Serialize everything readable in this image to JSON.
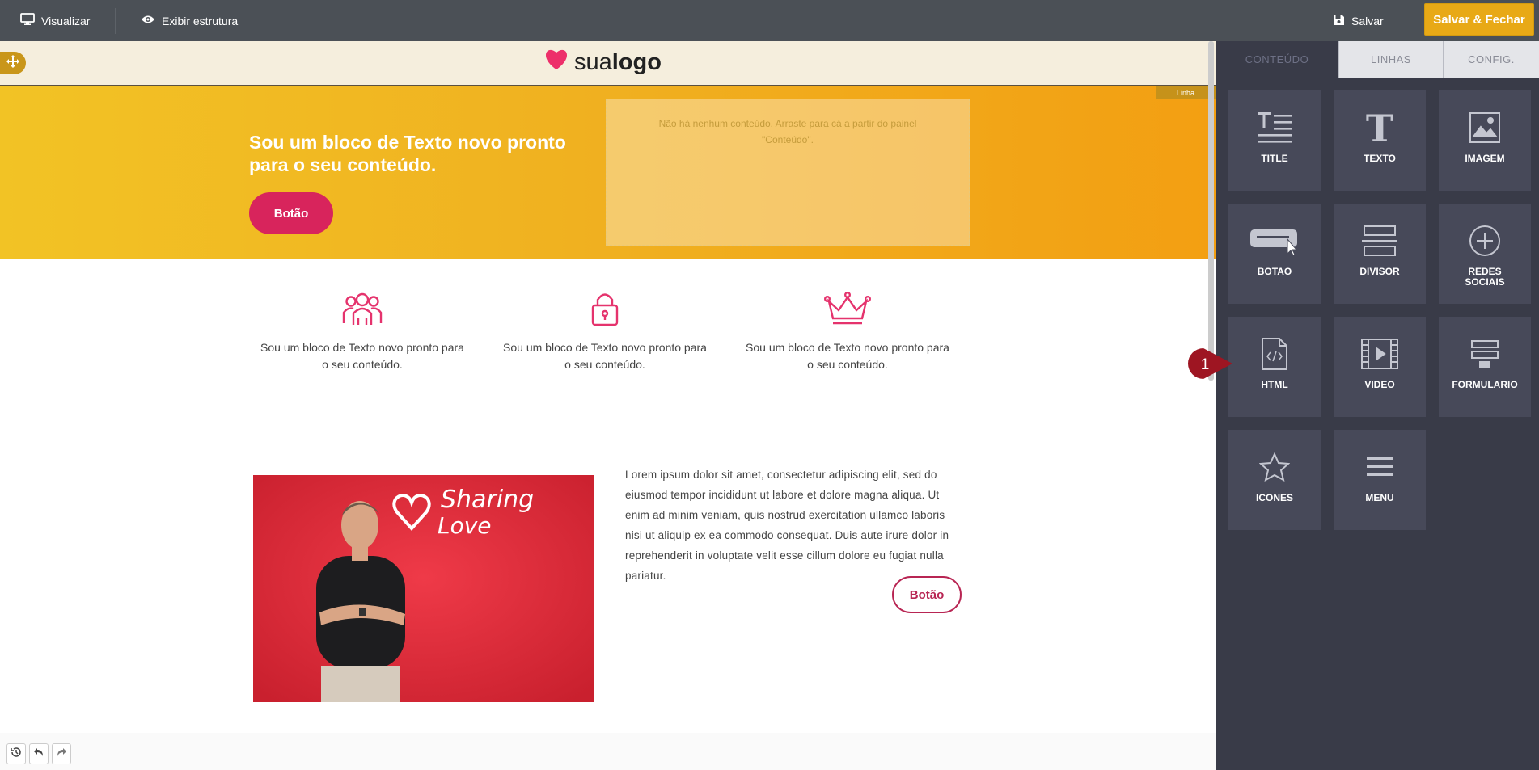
{
  "toolbar": {
    "preview_label": "Visualizar",
    "structure_label": "Exibir estrutura",
    "save_label": "Salvar",
    "save_close_label": "Salvar & Fechar"
  },
  "canvas": {
    "logo": {
      "text_light": "sua",
      "text_bold": "logo"
    },
    "row_tag": "Linha",
    "hero": {
      "title": "Sou um bloco de Texto novo pronto para o seu conteúdo.",
      "button_label": "Botão",
      "empty_message": "Não há nenhum conteúdo. Arraste para cá a partir do painel \"Conteúdo\"."
    },
    "features": [
      {
        "icon": "team-icon",
        "text": "Sou um bloco de Texto novo pronto para o seu conteúdo."
      },
      {
        "icon": "lock-icon",
        "text": "Sou um bloco de Texto novo pronto para o seu conteúdo."
      },
      {
        "icon": "crown-icon",
        "text": "Sou um bloco de Texto novo pronto para o seu conteúdo."
      }
    ],
    "photo_text": {
      "line1": "Sharing",
      "line2": "Love"
    },
    "lorem": "Lorem ipsum dolor sit amet, consectetur adipiscing elit, sed do eiusmod tempor incididunt ut labore et dolore magna aliqua. Ut enim ad minim veniam, quis nostrud exercitation ullamco laboris nisi ut aliquip ex ea commodo consequat. Duis aute irure dolor in reprehenderit in voluptate velit esse cillum dolore eu fugiat nulla pariatur.",
    "outline_button_label": "Botão"
  },
  "panel": {
    "tabs": [
      {
        "label": "CONTEÚDO",
        "active": true
      },
      {
        "label": "LINHAS",
        "active": false
      },
      {
        "label": "CONFIG.",
        "active": false
      }
    ],
    "tiles": [
      {
        "label": "TITLE",
        "icon": "title-icon"
      },
      {
        "label": "TEXTO",
        "icon": "text-icon"
      },
      {
        "label": "IMAGEM",
        "icon": "image-icon"
      },
      {
        "label": "BOTAO",
        "icon": "button-icon"
      },
      {
        "label": "DIVISOR",
        "icon": "divider-icon"
      },
      {
        "label": "REDES SOCIAIS",
        "icon": "social-plus-icon"
      },
      {
        "label": "HTML",
        "icon": "html-file-icon"
      },
      {
        "label": "VIDEO",
        "icon": "video-icon"
      },
      {
        "label": "FORMULARIO",
        "icon": "form-icon"
      },
      {
        "label": "ICONES",
        "icon": "star-icon"
      },
      {
        "label": "MENU",
        "icon": "menu-icon"
      }
    ]
  },
  "callout": {
    "number": "1",
    "color": "#9e1522"
  },
  "colors": {
    "accent": "#e8a916",
    "pink": "#d8245c",
    "panel_bg": "#393b48",
    "tile_bg": "#474959"
  }
}
